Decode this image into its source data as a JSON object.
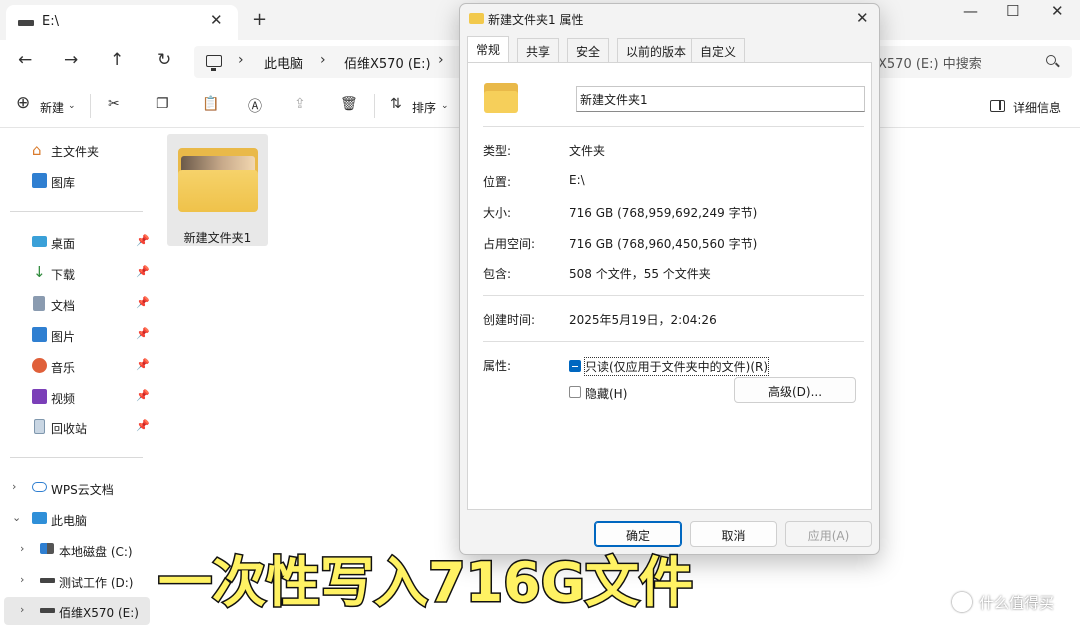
{
  "explorer": {
    "tab_title": "E:\\",
    "tab_close": "✕",
    "new_tab": "+",
    "window_controls": [
      "—",
      "☐",
      "✕"
    ],
    "nav": {
      "back": "←",
      "forward": "→",
      "up": "↑",
      "refresh": "↻"
    },
    "breadcrumb": [
      "此电脑",
      "佰维X570 (E:)"
    ],
    "search_placeholder": "X570 (E:) 中搜索",
    "toolbar": {
      "new_label": "新建",
      "sort_label": "排序",
      "details_label": "详细信息"
    },
    "sidebar": {
      "top": [
        {
          "label": "主文件夹",
          "icon": "home-icon"
        },
        {
          "label": "图库",
          "icon": "gallery-icon"
        }
      ],
      "quick": [
        {
          "label": "桌面",
          "icon": "desktop-icon"
        },
        {
          "label": "下载",
          "icon": "download-icon"
        },
        {
          "label": "文档",
          "icon": "document-icon"
        },
        {
          "label": "图片",
          "icon": "pictures-icon"
        },
        {
          "label": "音乐",
          "icon": "music-icon"
        },
        {
          "label": "视频",
          "icon": "video-icon"
        },
        {
          "label": "回收站",
          "icon": "recycle-bin-icon"
        }
      ],
      "tree": [
        {
          "label": "WPS云文档",
          "icon": "cloud-icon"
        },
        {
          "label": "此电脑",
          "icon": "monitor-icon"
        },
        {
          "label": "本地磁盘 (C:)",
          "icon": "windows-drive-icon"
        },
        {
          "label": "测试工作 (D:)",
          "icon": "drive-icon"
        },
        {
          "label": "佰维X570 (E:)",
          "icon": "drive-icon"
        }
      ]
    },
    "content": {
      "folder_name": "新建文件夹1"
    }
  },
  "dialog": {
    "title": "新建文件夹1 属性",
    "close": "✕",
    "tabs": [
      "常规",
      "共享",
      "安全",
      "以前的版本",
      "自定义"
    ],
    "name_value": "新建文件夹1",
    "properties": [
      {
        "label": "类型:",
        "value": "文件夹"
      },
      {
        "label": "位置:",
        "value": "E:\\"
      },
      {
        "label": "大小:",
        "value": "716 GB (768,959,692,249 字节)"
      },
      {
        "label": "占用空间:",
        "value": "716 GB (768,960,450,560 字节)"
      },
      {
        "label": "包含:",
        "value": "508 个文件，55 个文件夹"
      }
    ],
    "created_label": "创建时间:",
    "created_value": "2025年5月19日，2:04:26",
    "attributes_label": "属性:",
    "readonly_label": "只读(仅应用于文件夹中的文件)(R)",
    "hidden_label": "隐藏(H)",
    "advanced_button": "高级(D)...",
    "ok_button": "确定",
    "cancel_button": "取消",
    "apply_button": "应用(A)"
  },
  "overlay": {
    "caption": "一次性写入716G文件",
    "watermark": "什么值得买"
  }
}
